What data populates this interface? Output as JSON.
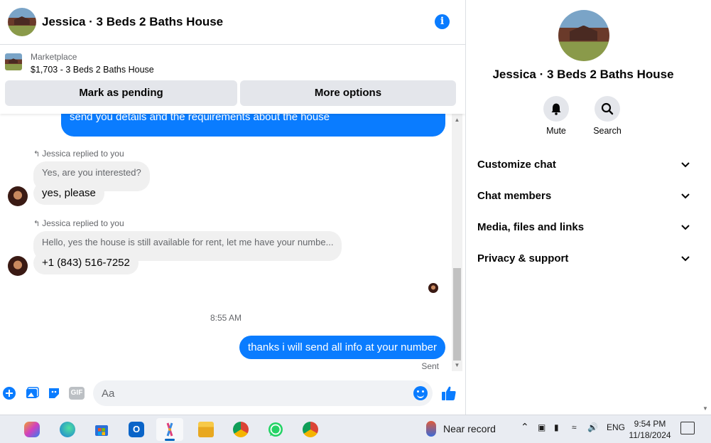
{
  "header": {
    "title": "Jessica · 3 Beds 2 Baths House",
    "info_icon": "i"
  },
  "marketplace": {
    "label": "Marketplace",
    "item": "$1,703 - 3 Beds 2 Baths House",
    "pending_label": "Mark as pending",
    "more_label": "More options"
  },
  "messages": {
    "out_partial_line2": "send you details and the requirements about the house",
    "reply1": {
      "note": "Jessica replied to you",
      "quote": "Yes, are you interested?",
      "text": "yes, please"
    },
    "reply2": {
      "note": "Jessica replied to you",
      "quote": "Hello, yes the house is still available for rent, let me have your numbe...",
      "text": "+1 (843) 516-7252"
    },
    "timestamp": "8:55 AM",
    "out_last": "thanks i will send all info at your number",
    "status": "Sent"
  },
  "composer": {
    "placeholder": "Aa",
    "gif_label": "GIF"
  },
  "info_panel": {
    "title": "Jessica · 3 Beds 2 Baths House",
    "mute_label": "Mute",
    "search_label": "Search",
    "sections": [
      "Customize chat",
      "Chat members",
      "Media, files and links",
      "Privacy & support"
    ]
  },
  "taskbar": {
    "weather": "Near record",
    "lang": "ENG",
    "time": "9:54 PM",
    "date": "11/18/2024"
  },
  "colors": {
    "accent": "#0a7cff",
    "bubble_in": "#f0f0f0",
    "button_gray": "#e4e6eb"
  }
}
